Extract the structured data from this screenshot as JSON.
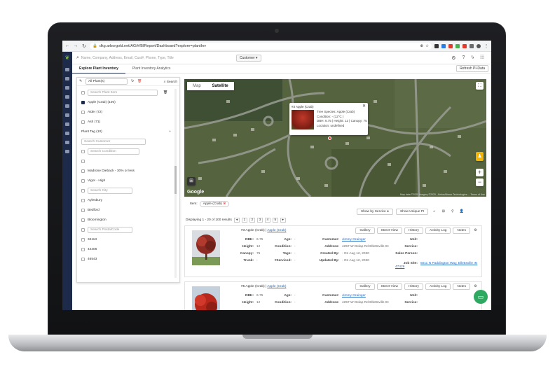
{
  "browser": {
    "url": "dkg.arborgold.net/AG/#/BIReport/Dashboard?explore=plantInv"
  },
  "appbar": {
    "search_placeholder": "Name, Company, Address, Email, Cust#, Phone, Type, Title",
    "customer_dropdown": "Customer ▾"
  },
  "tabs": [
    {
      "label": "Explore Plant Inventory"
    },
    {
      "label": "Plant Inventory Analytics"
    }
  ],
  "refresh_button": "Refresh PI-Data",
  "panel": {
    "select_value": "All Plant(s)",
    "search_button": "Search",
    "search_plant_placeholder": "Search Plant Item",
    "plant_items": [
      {
        "label": "Apple (Crab) (100)",
        "checked": true
      },
      {
        "label": "Alder (72)",
        "checked": false
      },
      {
        "label": "Ash (71)",
        "checked": false
      }
    ],
    "plant_tag": "Plant Tag (10)",
    "search_customer_placeholder": "Search Customer",
    "search_condition_placeholder": "Search Condition",
    "conditions": [
      " ",
      "Madrone Dieback - 30% or less",
      "Vigor - High"
    ],
    "search_city_placeholder": "Search City",
    "cities": [
      "Aylesbury",
      "Bedford",
      "Bloomington"
    ],
    "search_postal_placeholder": "Search PostalCode",
    "postal_codes": [
      "34113",
      "44406",
      "46543"
    ]
  },
  "map": {
    "tab_map": "Map",
    "tab_satellite": "Satellite",
    "google_logo": "Google",
    "attribution": "Map data ©2020 Imagery ©2020 , Airbus/Maxar Technologies ... Terms of Use",
    "popup": {
      "title": "#3 Apple (Crab)",
      "lines": [
        "Tree Species: Apple (Crab)",
        "Condition: - (12\"C )",
        "DBH: 6.75 | Height: 12 | Canopy: 75",
        "Location: undefined"
      ]
    }
  },
  "results": {
    "filter_label": "Item:",
    "filter_chip": "Apple (Crab)",
    "show_by_service": "Show by Service",
    "show_unique": "Show Unique PI",
    "displaying": "Displaying 1 - 20 of 100 results",
    "pages": [
      "1",
      "2",
      "3",
      "4",
      "5"
    ]
  },
  "cards": [
    {
      "title": "#3 Apple (Crab)",
      "title_link": "Apple (Crab)",
      "buttons": [
        "Gallery",
        "Street View",
        "History",
        "Activity Log",
        "Notes"
      ],
      "fields": {
        "dbh": "6.75",
        "height": "12",
        "canopy": "75",
        "trunk": "-",
        "age": "-",
        "condition": "-",
        "tags": "-",
        "serviced": "-",
        "customer": "Jimmy Grainger",
        "address": "4257 W Delap Rd Ellettsville IN",
        "created_by": "- On Aug 12, 2020",
        "updated_by": "- On Aug 12, 2020",
        "unit": "",
        "service": "",
        "sales_person": "",
        "job_site": "5011 N Paddington Way, Ellettsville IN 47429"
      }
    },
    {
      "title": "#5 Apple (Crab)",
      "title_link": "Apple (Crab)",
      "buttons": [
        "Gallery",
        "Street View",
        "History",
        "Activity Log",
        "Notes"
      ],
      "fields": {
        "dbh": "6.75",
        "height": "12",
        "age": "-",
        "condition": "-",
        "customer": "Jimmy Grainger",
        "address": "4257 W Delap Rd Ellettsville IN",
        "unit": "",
        "service": ""
      }
    }
  ],
  "labels": {
    "dbh": "DBH:",
    "height": "Height:",
    "canopy": "Canopy:",
    "trunk": "Trunk:",
    "age": "Age:",
    "condition": "Condition:",
    "tags": "Tags:",
    "serviced": "#Serviced:",
    "customer": "Customer:",
    "address": "Address:",
    "created_by": "Created By:",
    "updated_by": "Updated By:",
    "unit": "Unit:",
    "service": "Service:",
    "sales_person": "Sales Person:",
    "job_site": "Job Site:"
  }
}
